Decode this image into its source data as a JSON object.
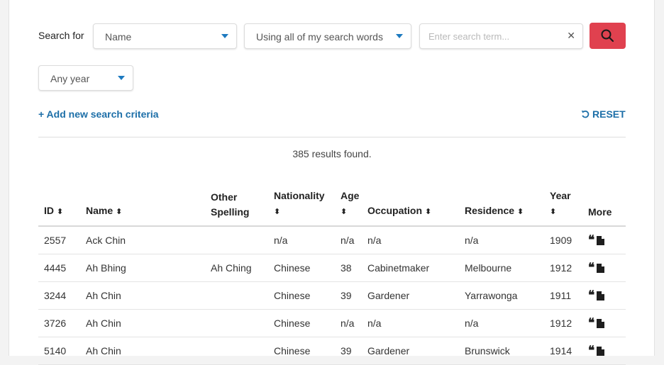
{
  "search": {
    "label": "Search for",
    "field_select": "Name",
    "mode_select": "Using all of my search words",
    "term_placeholder": "Enter search term...",
    "term_value": "",
    "year_select": "Any year",
    "add_criteria": "+ Add new search criteria",
    "reset": "RESET"
  },
  "results_summary": "385 results found.",
  "table": {
    "headers": {
      "id": "ID",
      "name": "Name",
      "other_spelling": "Other Spelling",
      "nationality": "Nationality",
      "age": "Age",
      "occupation": "Occupation",
      "residence": "Residence",
      "year": "Year",
      "more": "More"
    },
    "rows": [
      {
        "id": "2557",
        "name": "Ack Chin",
        "other_spelling": "",
        "nationality": "n/a",
        "age": "n/a",
        "occupation": "n/a",
        "residence": "n/a",
        "year": "1909"
      },
      {
        "id": "4445",
        "name": "Ah Bhing",
        "other_spelling": "Ah Ching",
        "nationality": "Chinese",
        "age": "38",
        "occupation": "Cabinetmaker",
        "residence": "Melbourne",
        "year": "1912"
      },
      {
        "id": "3244",
        "name": "Ah Chin",
        "other_spelling": "",
        "nationality": "Chinese",
        "age": "39",
        "occupation": "Gardener",
        "residence": "Yarrawonga",
        "year": "1911"
      },
      {
        "id": "3726",
        "name": "Ah Chin",
        "other_spelling": "",
        "nationality": "Chinese",
        "age": "n/a",
        "occupation": "n/a",
        "residence": "n/a",
        "year": "1912"
      },
      {
        "id": "5140",
        "name": "Ah Chin",
        "other_spelling": "",
        "nationality": "Chinese",
        "age": "39",
        "occupation": "Gardener",
        "residence": "Brunswick",
        "year": "1914"
      }
    ]
  },
  "colors": {
    "accent": "#1d6fa8",
    "search_button": "#e0414f"
  },
  "icons": {
    "search_button": "search-icon",
    "clear": "close-icon",
    "reset": "undo-icon",
    "sort": "sort-icon",
    "more_quote": "quote-icon",
    "more_doc": "document-icon"
  }
}
